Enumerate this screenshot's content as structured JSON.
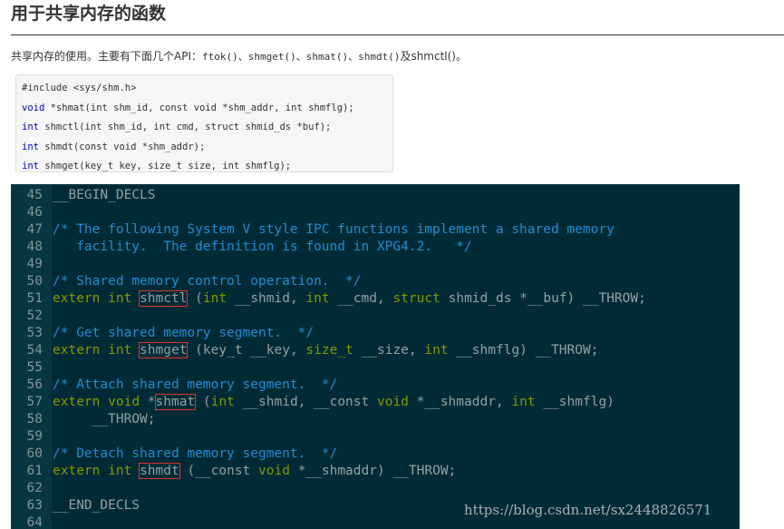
{
  "heading": "用于共享内存的函数",
  "intro": {
    "prefix": "共享内存的使用。主要有下面几个API：",
    "apis": "ftok()、shmget()、shmat()、shmdt()",
    "suffix": "及shmctl()。"
  },
  "header_box": {
    "lines": [
      "#include <sys/shm.h>",
      "void *shmat(int shm_id, const void *shm_addr, int shmflg);",
      "int shmctl(int shm_id, int cmd, struct shmid_ds *buf);",
      "int shmdt(const void *shm_addr);",
      "int shmget(key_t key, size_t size, int shmflg);"
    ]
  },
  "terminal": {
    "line_numbers": [
      "45",
      "46",
      "47",
      "48",
      "49",
      "50",
      "51",
      "52",
      "53",
      "54",
      "55",
      "56",
      "57",
      "58",
      "59",
      "60",
      "61",
      "62",
      "63",
      "64"
    ],
    "l45": "__BEGIN_DECLS",
    "l47": "/* The following System V style IPC functions implement a shared memory",
    "l48": "   facility.  The definition is found in XPG4.2.   */",
    "l50": "/* Shared memory control operation.  */",
    "l51": {
      "a": "extern",
      "b": "int",
      "fn": "shmctl",
      "c": " (int __shmid, int __cmd, struct shmid_ds *__buf) __THROW;"
    },
    "l53": "/* Get shared memory segment.  */",
    "l54": {
      "a": "extern",
      "b": "int",
      "fn": "shmget",
      "c": " (key_t __key, size_t __size, int __shmflg) __THROW;"
    },
    "l56": "/* Attach shared memory segment.  */",
    "l57": {
      "a": "extern",
      "b": "void",
      "star": "*",
      "fn": "shmat",
      "c": " (int __shmid, __const void *__shmaddr, int __shmflg)"
    },
    "l58": "     __THROW;",
    "l60": "/* Detach shared memory segment.  */",
    "l61": {
      "a": "extern",
      "b": "int",
      "fn": "shmdt",
      "c": " (__const void *__shmaddr) __THROW;"
    },
    "l63": "__END_DECLS"
  },
  "watermark": "https://blog.csdn.net/sx2448826571"
}
